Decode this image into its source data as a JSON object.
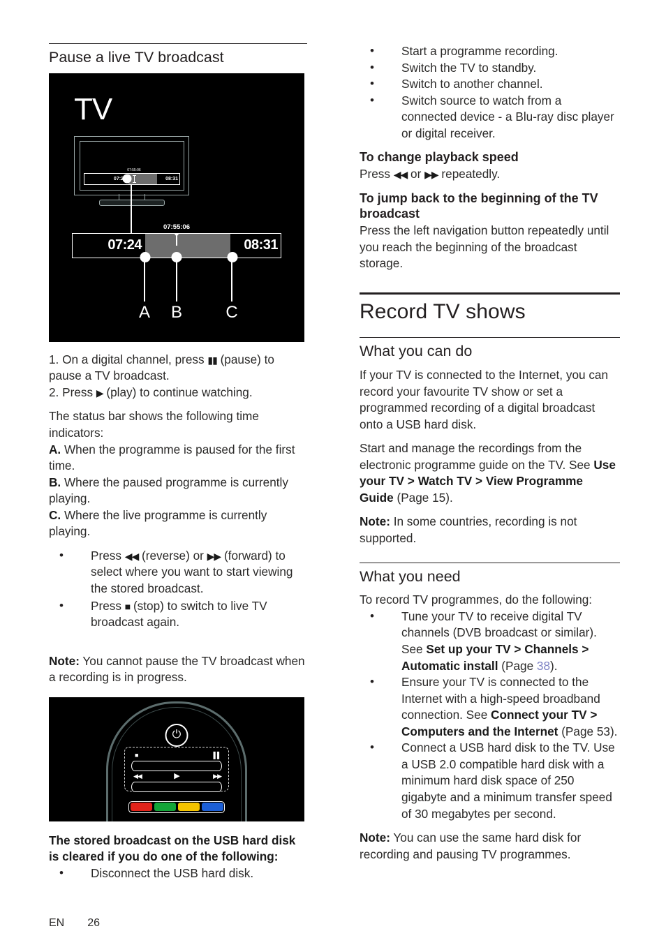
{
  "footer": {
    "lang": "EN",
    "page": "26"
  },
  "left": {
    "heading": "Pause a live TV broadcast",
    "figure_tv": {
      "caption_word": "TV",
      "mini_time_start": "07:24",
      "mini_time_end": "08:31",
      "mini_current": "07:55:06",
      "bar_time_start": "07:24",
      "bar_time_end": "08:31",
      "bar_current_time": "07:55:06",
      "labels": [
        "A",
        "B",
        "C"
      ]
    },
    "step1_pre": "1. On a digital channel, press ",
    "step1_glyph": "▮▮",
    "step1_post": " (pause) to pause a TV broadcast.",
    "step2_pre": "2. Press ",
    "step2_glyph": "▶",
    "step2_post": " (play) to continue watching.",
    "status_intro": "The status bar shows the following time indicators:",
    "indicator_a_label": "A.",
    "indicator_a_text": " When the programme is paused for the first time.",
    "indicator_b_label": "B.",
    "indicator_b_text": " Where the paused programme is currently playing.",
    "indicator_c_label": "C.",
    "indicator_c_text": " Where the live programme is currently playing.",
    "bullet_reverse_pre": "Press ",
    "bullet_reverse_glyph": "◀◀",
    "bullet_reverse_mid": " (reverse) or ",
    "bullet_forward_glyph": "▶▶",
    "bullet_reverse_post": " (forward) to select where you want to start viewing the stored broadcast.",
    "bullet_stop_pre": "Press ",
    "bullet_stop_glyph": "■",
    "bullet_stop_post": " (stop) to switch to live TV broadcast again.",
    "note_label": "Note:",
    "note_text": " You cannot pause the TV broadcast when a recording is in progress.",
    "figure_remote": {
      "power_icon": "⏻",
      "stop_icon": "■",
      "pause_icon": "▐▐",
      "reverse_icon": "◀◀",
      "play_icon": "▶",
      "forward_icon": "▶▶",
      "colors": [
        "#e2231a",
        "#13a538",
        "#f5c400",
        "#1c5fd6"
      ]
    },
    "cleared_heading": "The stored broadcast on the USB hard disk is cleared if you do one of the following:",
    "cleared_bullet": "Disconnect the USB hard disk."
  },
  "right": {
    "top_bullets": [
      "Start a programme recording.",
      "Switch the TV to standby.",
      "Switch to another channel.",
      "Switch source to watch from a connected device - a Blu-ray disc player or digital receiver."
    ],
    "speed_heading": "To change playback speed",
    "speed_pre": "Press ",
    "speed_rev_glyph": "◀◀",
    "speed_mid": " or ",
    "speed_fwd_glyph": "▶▶",
    "speed_post": " repeatedly.",
    "jump_heading": "To jump back to the beginning of the TV broadcast",
    "jump_text": "Press the left navigation button repeatedly until you reach the beginning of the broadcast storage.",
    "chapter_title": "Record TV shows",
    "what_can_do_heading": "What you can do",
    "what_can_do_p1": "If your TV is connected to the Internet, you can record your favourite TV show or set a programmed recording of a digital broadcast onto a USB hard disk.",
    "what_can_do_p2_pre": "Start and manage the recordings from the electronic programme guide on the TV. See ",
    "what_can_do_p2_bold": "Use your TV > Watch TV > View Programme Guide",
    "what_can_do_p2_post": " (Page 15).",
    "note1_label": "Note:",
    "note1_text": " In some countries, recording is not supported.",
    "what_you_need_heading": "What you need",
    "need_intro": "To record TV programmes, do the following:",
    "need_b1_pre": "Tune your TV to receive digital TV channels (DVB broadcast or similar). See ",
    "need_b1_bold": "Set up your TV > Channels > Automatic install",
    "need_b1_mid": " (Page ",
    "need_b1_link": "38",
    "need_b1_post": ").",
    "need_b2_pre": "Ensure your TV is connected to the Internet with a high-speed broadband connection. See ",
    "need_b2_bold": "Connect your TV > Computers and the Internet",
    "need_b2_post": " (Page 53).",
    "need_b3": "Connect a USB hard disk to the TV. Use a USB 2.0 compatible hard disk with a minimum hard disk space of 250 gigabyte and a minimum transfer speed of 30 megabytes per second.",
    "note2_label": "Note:",
    "note2_text": " You can use the same hard disk for recording and pausing TV programmes."
  }
}
